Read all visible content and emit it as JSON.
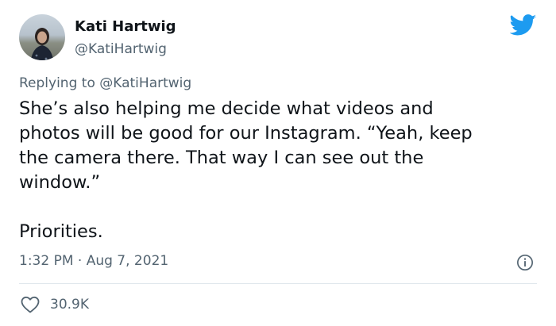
{
  "author": {
    "name": "Kati Hartwig",
    "handle": "@KatiHartwig"
  },
  "reply": {
    "prefix": "Replying to ",
    "mention": "@KatiHartwig"
  },
  "tweet": {
    "text": "She’s also helping me decide what videos and\nphotos will be good for our Instagram. “Yeah, keep\nthe camera there. That way I can see out the\nwindow.”\n\nPriorities.",
    "timestamp": "1:32 PM · Aug 7, 2021"
  },
  "stats": {
    "likes": "30.9K"
  },
  "icons": {
    "brand": "twitter-bird-icon",
    "info": "info-icon",
    "like": "heart-icon"
  },
  "colors": {
    "brand": "#1d9bf0",
    "secondary_text": "#536471",
    "primary_text": "#0f1419"
  }
}
